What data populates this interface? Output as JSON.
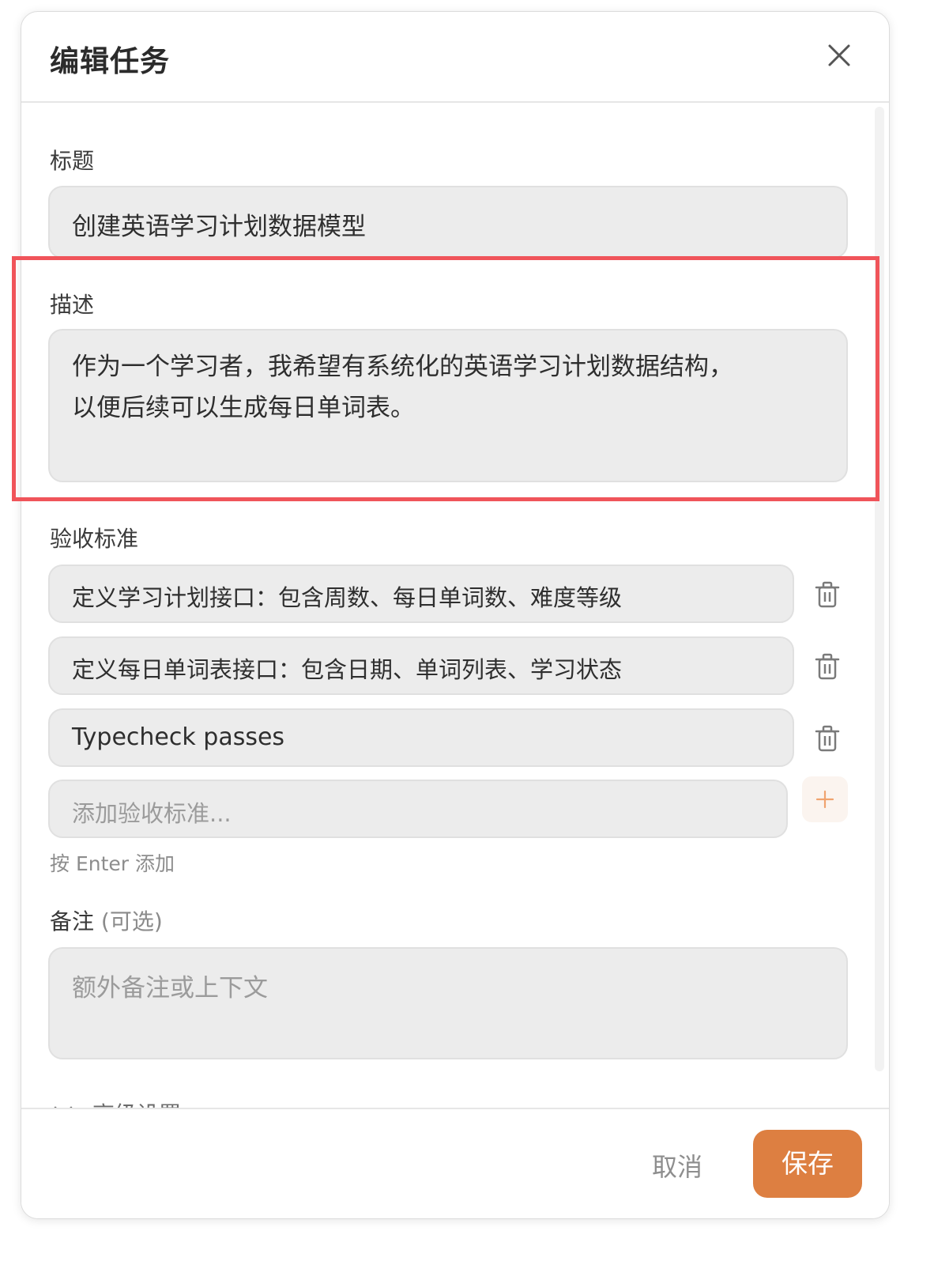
{
  "dialog": {
    "title": "编辑任务"
  },
  "fields": {
    "title_label": "标题",
    "title_value": "创建英语学习计划数据模型",
    "description_label": "描述",
    "description_line1": "作为一个学习者，我希望有系统化的英语学习计划数据结构，",
    "description_line2": "以便后续可以生成每日单词表。",
    "criteria_label": "验收标准",
    "criteria": [
      "定义学习计划接口：包含周数、每日单词数、难度等级",
      "定义每日单词表接口：包含日期、单词列表、学习状态",
      "Typecheck passes"
    ],
    "criteria_placeholder": "添加验收标准...",
    "criteria_hint": "按 Enter 添加",
    "notes_label": "备注",
    "notes_optional": "(可选)",
    "notes_placeholder": "额外备注或上下文",
    "advanced_label": "高级设置"
  },
  "footer": {
    "cancel_label": "取消",
    "save_label": "保存"
  },
  "colors": {
    "accent": "#dd7f41",
    "highlight_border": "#f0545a",
    "field_bg": "#ececec"
  },
  "icons": [
    "close-icon",
    "trash-icon",
    "plus-icon",
    "chevron-down-icon"
  ]
}
